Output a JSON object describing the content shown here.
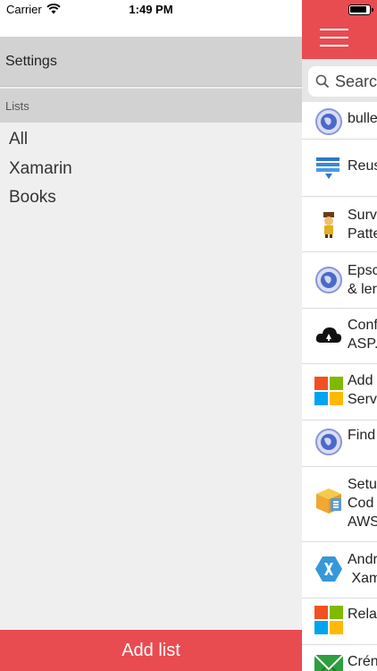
{
  "status": {
    "carrier": "Carrier",
    "time": "1:49 PM"
  },
  "drawer": {
    "settings_label": "Settings",
    "lists_header": "Lists",
    "lists": [
      "All",
      "Xamarin",
      "Books"
    ],
    "add_list_label": "Add list"
  },
  "main": {
    "search_placeholder": "Search",
    "feed": [
      {
        "icon": "globe-icon",
        "lines": [
          "bulle"
        ]
      },
      {
        "icon": "stack-icon",
        "lines": [
          "Reus"
        ]
      },
      {
        "icon": "character-icon",
        "lines": [
          "Surv",
          "Patte"
        ]
      },
      {
        "icon": "globe-icon",
        "lines": [
          "Epsc",
          "& ler"
        ]
      },
      {
        "icon": "cloud-icon",
        "lines": [
          "Conf",
          "ASP."
        ]
      },
      {
        "icon": "microsoft-icon",
        "lines": [
          "Add",
          "Serv"
        ]
      },
      {
        "icon": "globe-icon",
        "lines": [
          "Find"
        ]
      },
      {
        "icon": "box-icon",
        "lines": [
          "Setu",
          "Cod",
          "AWS"
        ]
      },
      {
        "icon": "xamarin-icon",
        "lines": [
          "Andr",
          " Xam"
        ]
      },
      {
        "icon": "microsoft-icon",
        "lines": [
          "Rela"
        ]
      },
      {
        "icon": "envelope-icon",
        "lines": [
          "Crén"
        ]
      }
    ]
  },
  "colors": {
    "accent": "#e84b50",
    "drawer_bg": "#efefef",
    "section_bg": "#d2d2d2"
  }
}
